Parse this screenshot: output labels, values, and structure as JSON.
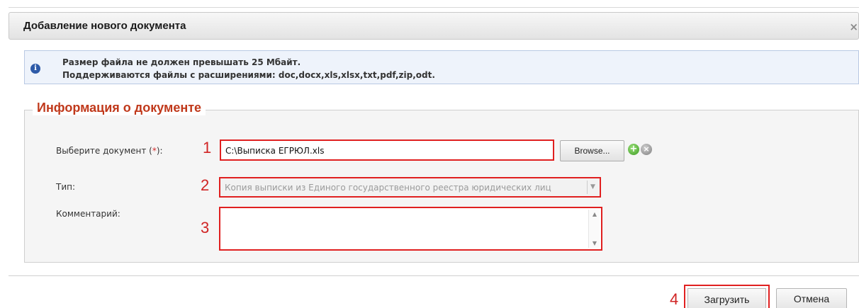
{
  "dialog": {
    "title": "Добавление нового документа",
    "close_glyph": "×"
  },
  "info": {
    "line1": "Размер файла не должен превышать 25 Мбайт.",
    "line2": "Поддерживаются файлы с расширениями: doc,docx,xls,xlsx,txt,pdf,zip,odt.",
    "icon": "info-icon"
  },
  "section": {
    "legend": "Информация о документе"
  },
  "form": {
    "document_label": "Выберите документ (",
    "required_mark": "*",
    "document_label_end": "):",
    "document_value": "C:\\Выписка ЕГРЮЛ.xls",
    "browse_label": "Browse...",
    "type_label": "Тип:",
    "type_value": "Копия выписки из Единого государственного реестра юридических лиц",
    "comment_label": "Комментарий:",
    "comment_value": ""
  },
  "annotations": {
    "n1": "1",
    "n2": "2",
    "n3": "3",
    "n4": "4"
  },
  "footer": {
    "upload_label": "Загрузить",
    "cancel_label": "Отмена"
  },
  "colors": {
    "highlight": "#e02020",
    "legend": "#c0391b",
    "info_bg": "#eef3fb"
  }
}
